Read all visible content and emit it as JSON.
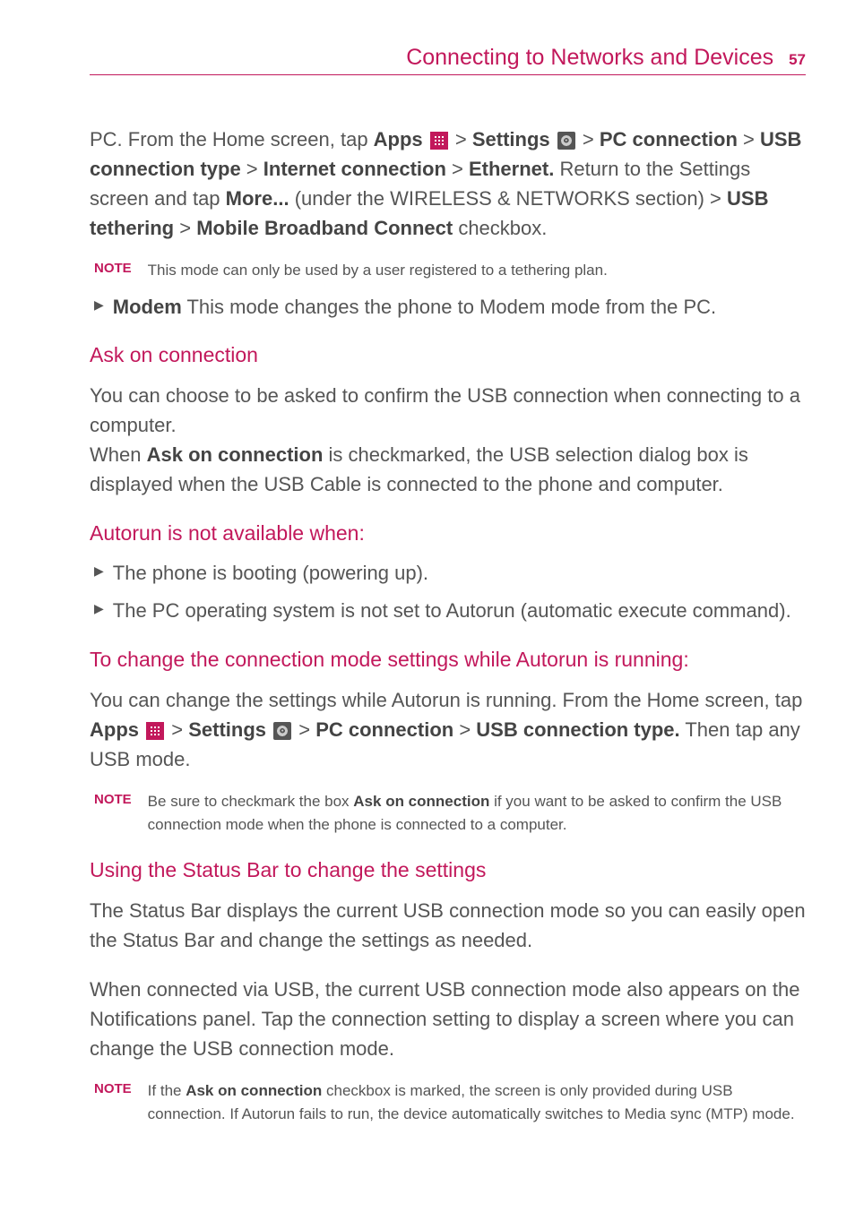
{
  "header": {
    "title": "Connecting to Networks and Devices",
    "page": "57"
  },
  "para1": {
    "t1": "PC. From the Home screen, tap ",
    "apps": "Apps",
    "t2": " > ",
    "settings": "Settings",
    "t3": " > ",
    "pc_conn": "PC connection",
    "t4": " > ",
    "usb_type": "USB connection type",
    "t5": " > ",
    "internet_conn": "Internet connection",
    "t6": " > ",
    "ethernet": "Ethernet.",
    "t7": " Return to the Settings screen and tap ",
    "more": "More...",
    "t8": " (under the WIRELESS & NETWORKS section) > ",
    "usb_tether": "USB tethering",
    "t9": " > ",
    "mobile": "Mobile Broadband Connect",
    "t10": " checkbox."
  },
  "note1": {
    "label": "NOTE",
    "text": "This mode can only be used by a user registered to a tethering plan."
  },
  "bullet_modem": {
    "bold": "Modem",
    "text": " This mode changes the phone to Modem mode from the PC."
  },
  "heading_ask": "Ask on connection",
  "para_ask1": "You can choose to be asked to confirm the USB connection when connecting to a computer.",
  "para_ask2": {
    "t1": "When ",
    "bold": "Ask on connection",
    "t2": " is checkmarked, the USB selection dialog box is displayed when the USB Cable is connected to the phone and computer."
  },
  "heading_autorun": "Autorun is not available when:",
  "bullet_autorun1": "The phone is booting (powering up).",
  "bullet_autorun2": "The PC operating system is not set to Autorun (automatic execute command).",
  "heading_change": "To change the connection mode settings while Autorun is running:",
  "para_change": {
    "t1": "You can change the settings while Autorun is running. From the Home screen, tap ",
    "apps": "Apps",
    "t2": " > ",
    "settings": "Settings",
    "t3": " > ",
    "pc_conn": "PC connection",
    "t4": " > ",
    "usb_type": "USB connection type.",
    "t5": " Then tap any USB mode."
  },
  "note2": {
    "label": "NOTE",
    "t1": "Be sure to checkmark the box ",
    "bold": "Ask on connection",
    "t2": " if you want to be asked to confirm the USB connection mode when the phone is connected to a computer."
  },
  "heading_status": "Using the Status Bar to change the settings",
  "para_status1": "The Status Bar displays the current USB connection mode so you can easily open the Status Bar and change the settings as needed.",
  "para_status2": "When connected via USB, the current USB connection mode also appears on the Notifications panel. Tap the connection setting to display a screen where you can change the USB connection mode.",
  "note3": {
    "label": "NOTE",
    "t1": "If the ",
    "bold": "Ask on connection",
    "t2": " checkbox is marked, the screen is only provided during USB connection. If Autorun fails to run, the device automatically switches to Media sync (MTP) mode."
  }
}
